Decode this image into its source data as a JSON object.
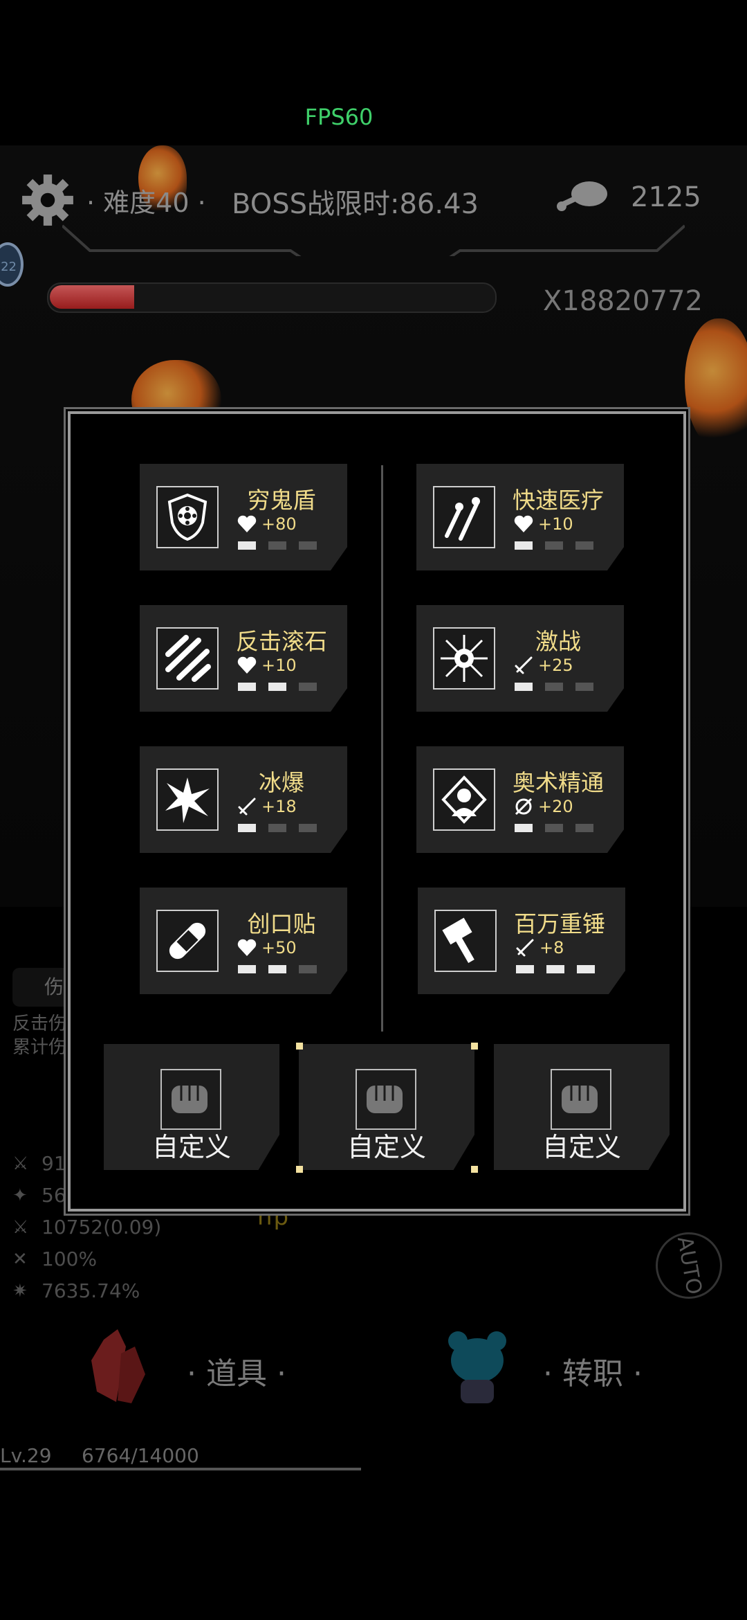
{
  "hud": {
    "fps": "FPS60",
    "difficulty": "· 难度40 ·",
    "boss_timer": "BOSS战限时:86.43",
    "meat_count": "2125",
    "multiplier": "X18820772",
    "boss_hp_fraction": 0.19,
    "badge_text": "22"
  },
  "skills": [
    {
      "name": "穷鬼盾",
      "buff_icon": "heart-icon",
      "buff": "+80",
      "level": 1,
      "icon": "shield-icon"
    },
    {
      "name": "快速医疗",
      "buff_icon": "heart-icon",
      "buff": "+10",
      "level": 1,
      "icon": "syringe-icon"
    },
    {
      "name": "反击滚石",
      "buff_icon": "heart-icon",
      "buff": "+10",
      "level": 2,
      "icon": "meteor-icon"
    },
    {
      "name": "激战",
      "buff_icon": "sword-icon",
      "buff": "+25",
      "level": 1,
      "icon": "burst-icon"
    },
    {
      "name": "冰爆",
      "buff_icon": "sword-icon",
      "buff": "+18",
      "level": 1,
      "icon": "ice-burst-icon"
    },
    {
      "name": "奥术精通",
      "buff_icon": "arcane-icon",
      "buff": "+20",
      "level": 1,
      "icon": "arcane-master-icon"
    },
    {
      "name": "创口贴",
      "buff_icon": "heart-icon",
      "buff": "+50",
      "level": 2,
      "icon": "bandage-icon"
    },
    {
      "name": "百万重锤",
      "buff_icon": "sword-icon",
      "buff": "+8",
      "level": 3,
      "icon": "hammer-icon"
    }
  ],
  "custom_slots": [
    {
      "label": "自定义"
    },
    {
      "label": "自定义"
    },
    {
      "label": "自定义"
    }
  ],
  "background_stats": {
    "panel_label": "伤害",
    "line1": "反击伤",
    "line2": "累计伤",
    "rows": [
      {
        "icon": "sword-icon",
        "value": "91"
      },
      {
        "icon": "crit-icon",
        "value": "56"
      },
      {
        "icon": "sword-speed-icon",
        "value": "10752(0.09)"
      },
      {
        "icon": "cross-swords-icon",
        "value": "100%"
      },
      {
        "icon": "spark-icon",
        "value": "7635.74%"
      }
    ]
  },
  "hp_text": "hp",
  "auto": "AUTO",
  "dock": {
    "items": "· 道具 ·",
    "job": "· 转职 ·"
  },
  "level": {
    "lv": "Lv.29",
    "xp": "6764/14000",
    "xp_fraction": 0.483
  },
  "colors": {
    "accent_gold": "#f1dc8a",
    "fps_green": "#3fd06a"
  }
}
